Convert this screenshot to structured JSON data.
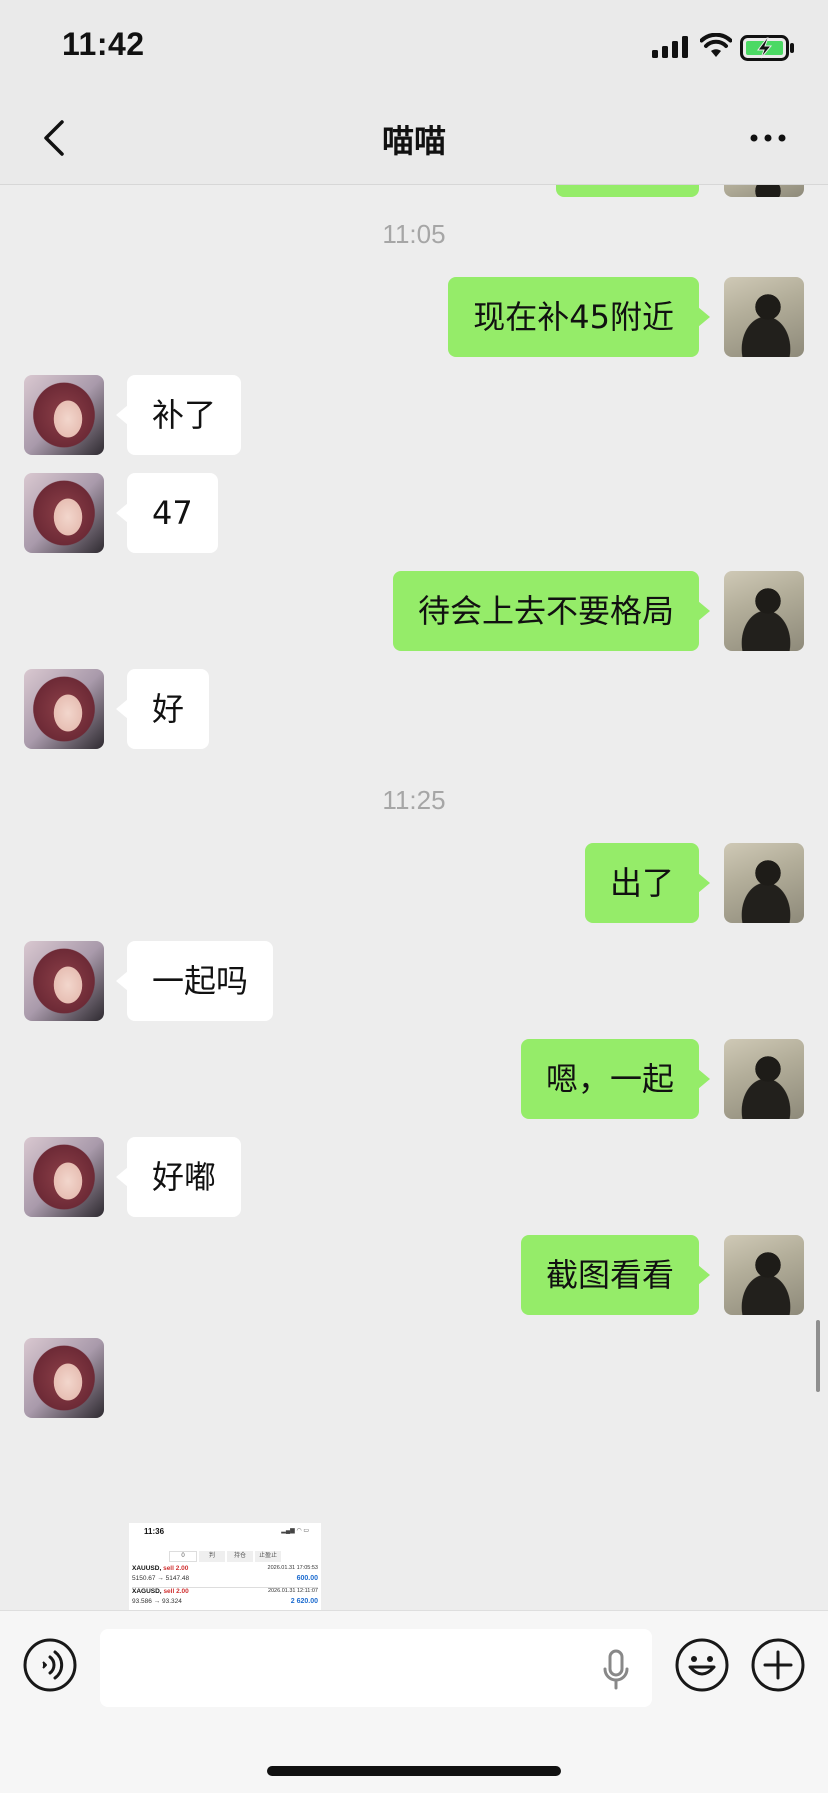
{
  "status_bar": {
    "time": "11:42"
  },
  "header": {
    "title": "喵喵"
  },
  "messages": [
    {
      "type": "time",
      "text": "11:05"
    },
    {
      "sender": "me",
      "text": "现在补45附近"
    },
    {
      "sender": "her",
      "text": "补了"
    },
    {
      "sender": "her",
      "text": "47"
    },
    {
      "sender": "me",
      "text": "待会上去不要格局"
    },
    {
      "sender": "her",
      "text": "好"
    },
    {
      "type": "time",
      "text": "11:25"
    },
    {
      "sender": "me",
      "text": "出了"
    },
    {
      "sender": "her",
      "text": "一起吗"
    },
    {
      "sender": "me",
      "text": "嗯，一起"
    },
    {
      "sender": "her",
      "text": "好嘟"
    },
    {
      "sender": "me",
      "text": "截图看看"
    }
  ],
  "image_message": {
    "time": "11:36",
    "tabs": [
      "0",
      "判",
      "持仓",
      "止盈止"
    ],
    "rows": [
      {
        "symbol": "XAUUSD,",
        "side": "sell 2.00",
        "prices": "5150.67 → 5147.48",
        "date": "2026.01.31 17:05:53",
        "profit": "600.00"
      },
      {
        "symbol": "XAGUSD,",
        "side": "sell 2.00",
        "prices": "93.586 → 93.324",
        "date": "2026.01.31 12:11:07",
        "profit": "2 620.00"
      }
    ]
  },
  "input": {
    "placeholder": ""
  },
  "icons": {
    "back": "chevron-left-icon",
    "more": "more-dots-icon",
    "voice": "voice-icon",
    "mic": "microphone-icon",
    "emoji": "emoji-icon",
    "plus": "plus-icon"
  },
  "colors": {
    "outgoing_bubble": "#95EC69",
    "incoming_bubble": "#FFFFFF",
    "background": "#EDEDED"
  }
}
